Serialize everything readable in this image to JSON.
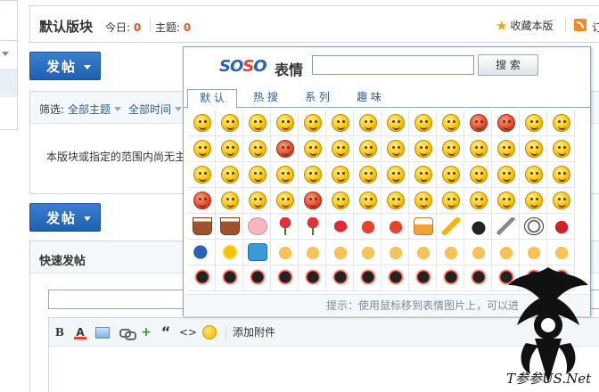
{
  "forum": {
    "title": "默认版块",
    "today_label": "今日:",
    "today_value": "0",
    "topics_label": "主题:",
    "topics_value": "0",
    "favorite_label": "收藏本版",
    "subscribe_label": "订"
  },
  "post_button_label": "发帖",
  "filter": {
    "label": "筛选:",
    "all_topics": "全部主题",
    "all_time": "全部时间"
  },
  "empty_message": "本版块或指定的范围内尚无主",
  "quick_post": {
    "title": "快速发帖",
    "attach_label": "添加附件"
  },
  "emoticon_popup": {
    "logo_latin": "SOSO",
    "logo_cn": "表情",
    "search_button": "搜 索",
    "tabs": [
      "默 认",
      "热 搜",
      "系 列",
      "趣 味"
    ],
    "active_tab": 0,
    "hint": "提示：使用鼠标移到表情图片上，可以进"
  },
  "watermark_text": "T参参US.Net",
  "colors": {
    "accent": "#1f5fae",
    "stat_number": "#e05a2b",
    "link": "#2b5d97"
  }
}
